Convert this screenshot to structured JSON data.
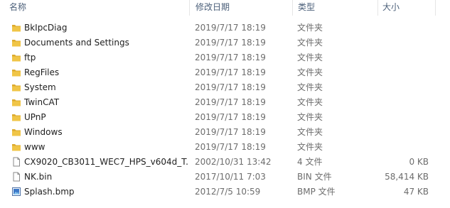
{
  "columns": {
    "name": "名称",
    "date": "修改日期",
    "type": "类型",
    "size": "大小"
  },
  "colors": {
    "folder": "#f0c547",
    "folder_dark": "#dcaa2e",
    "header_text": "#4c607a",
    "secondary_text": "#6d6d6d"
  },
  "files": [
    {
      "icon": "folder-icon",
      "name": "BkIpcDiag",
      "date": "2019/7/17 18:19",
      "type": "文件夹",
      "size": ""
    },
    {
      "icon": "folder-icon",
      "name": "Documents and Settings",
      "date": "2019/7/17 18:19",
      "type": "文件夹",
      "size": ""
    },
    {
      "icon": "folder-icon",
      "name": "ftp",
      "date": "2019/7/17 18:19",
      "type": "文件夹",
      "size": ""
    },
    {
      "icon": "folder-icon",
      "name": "RegFiles",
      "date": "2019/7/17 18:19",
      "type": "文件夹",
      "size": ""
    },
    {
      "icon": "folder-icon",
      "name": "System",
      "date": "2019/7/17 18:19",
      "type": "文件夹",
      "size": ""
    },
    {
      "icon": "folder-icon",
      "name": "TwinCAT",
      "date": "2019/7/17 18:19",
      "type": "文件夹",
      "size": ""
    },
    {
      "icon": "folder-icon",
      "name": "UPnP",
      "date": "2019/7/17 18:19",
      "type": "文件夹",
      "size": ""
    },
    {
      "icon": "folder-icon",
      "name": "Windows",
      "date": "2019/7/17 18:19",
      "type": "文件夹",
      "size": ""
    },
    {
      "icon": "folder-icon",
      "name": "www",
      "date": "2019/7/17 18:19",
      "type": "文件夹",
      "size": ""
    },
    {
      "icon": "file-icon",
      "name": "CX9020_CB3011_WEC7_HPS_v604d_T...",
      "date": "2002/10/31 13:42",
      "type": "4 文件",
      "size": "0 KB"
    },
    {
      "icon": "file-icon",
      "name": "NK.bin",
      "date": "2017/10/11 7:03",
      "type": "BIN 文件",
      "size": "58,414 KB"
    },
    {
      "icon": "bmp-image-icon",
      "name": "Splash.bmp",
      "date": "2012/7/5 10:59",
      "type": "BMP 文件",
      "size": "47 KB"
    }
  ]
}
